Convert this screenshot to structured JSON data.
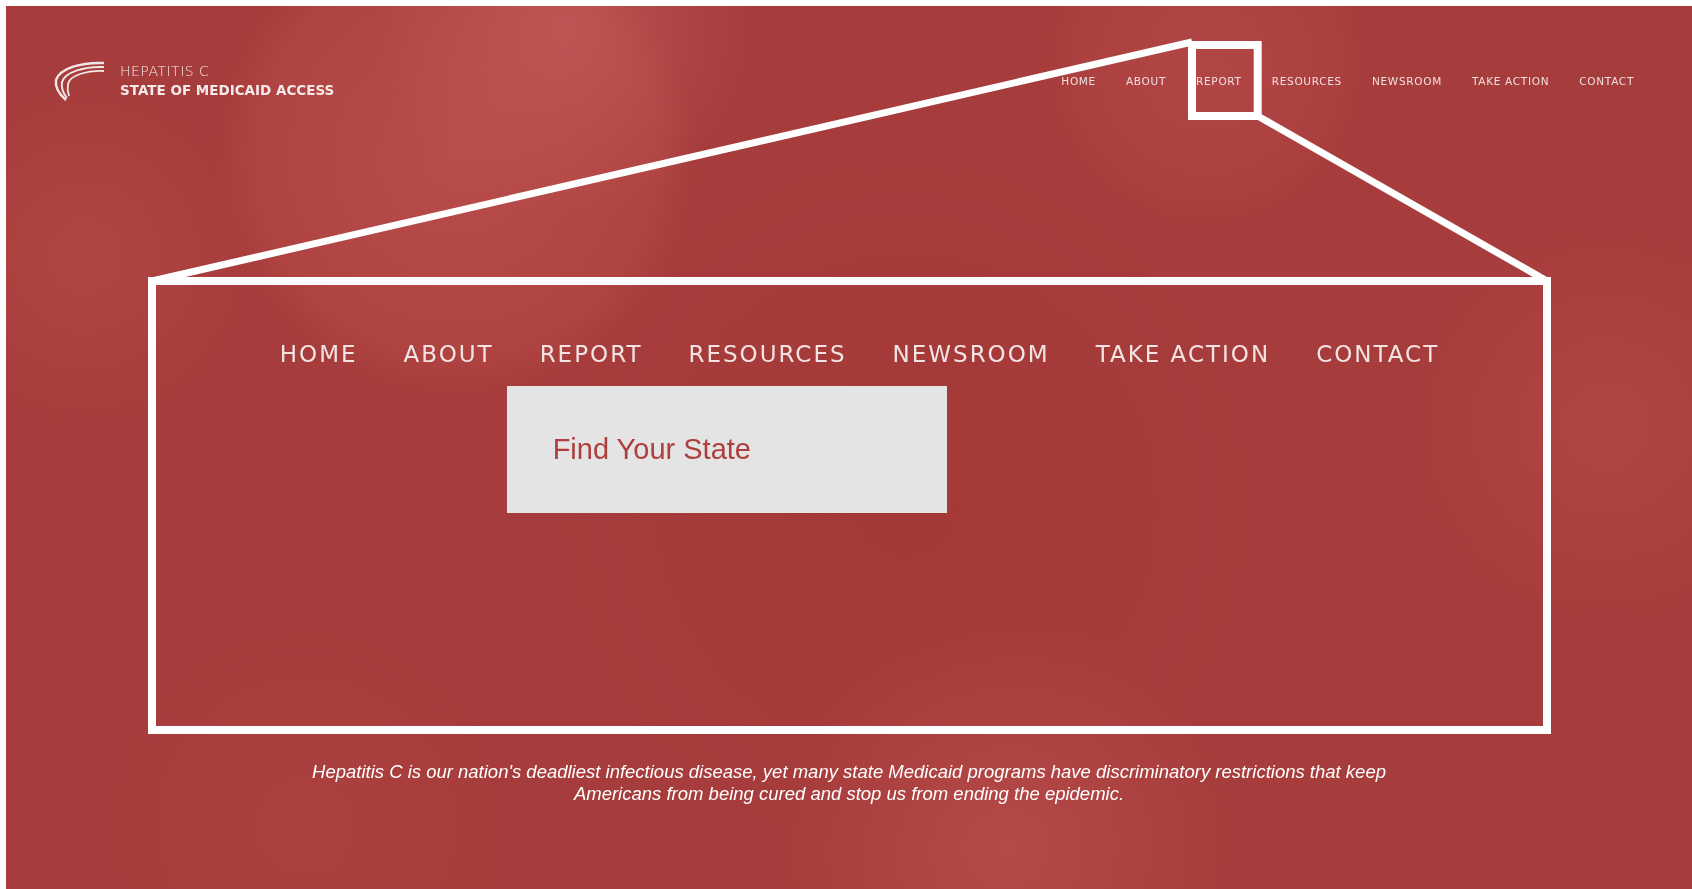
{
  "header": {
    "logo": {
      "line1": "HEPATITIS C",
      "line2": "STATE OF MEDICAID ACCESS"
    },
    "nav": [
      {
        "label": "HOME"
      },
      {
        "label": "ABOUT"
      },
      {
        "label": "REPORT"
      },
      {
        "label": "RESOURCES"
      },
      {
        "label": "NEWSROOM"
      },
      {
        "label": "TAKE ACTION"
      },
      {
        "label": "CONTACT"
      }
    ]
  },
  "zoom_callout": {
    "nav": [
      {
        "label": "HOME"
      },
      {
        "label": "ABOUT"
      },
      {
        "label": "REPORT",
        "dropdown": [
          "Find Your State"
        ]
      },
      {
        "label": "RESOURCES"
      },
      {
        "label": "NEWSROOM"
      },
      {
        "label": "TAKE ACTION"
      },
      {
        "label": "CONTACT"
      }
    ]
  },
  "tagline": "Hepatitis C is our nation's deadliest infectious disease, yet many state Medicaid programs have discriminatory restrictions that keep Americans from being cured and stop us from ending the epidemic."
}
